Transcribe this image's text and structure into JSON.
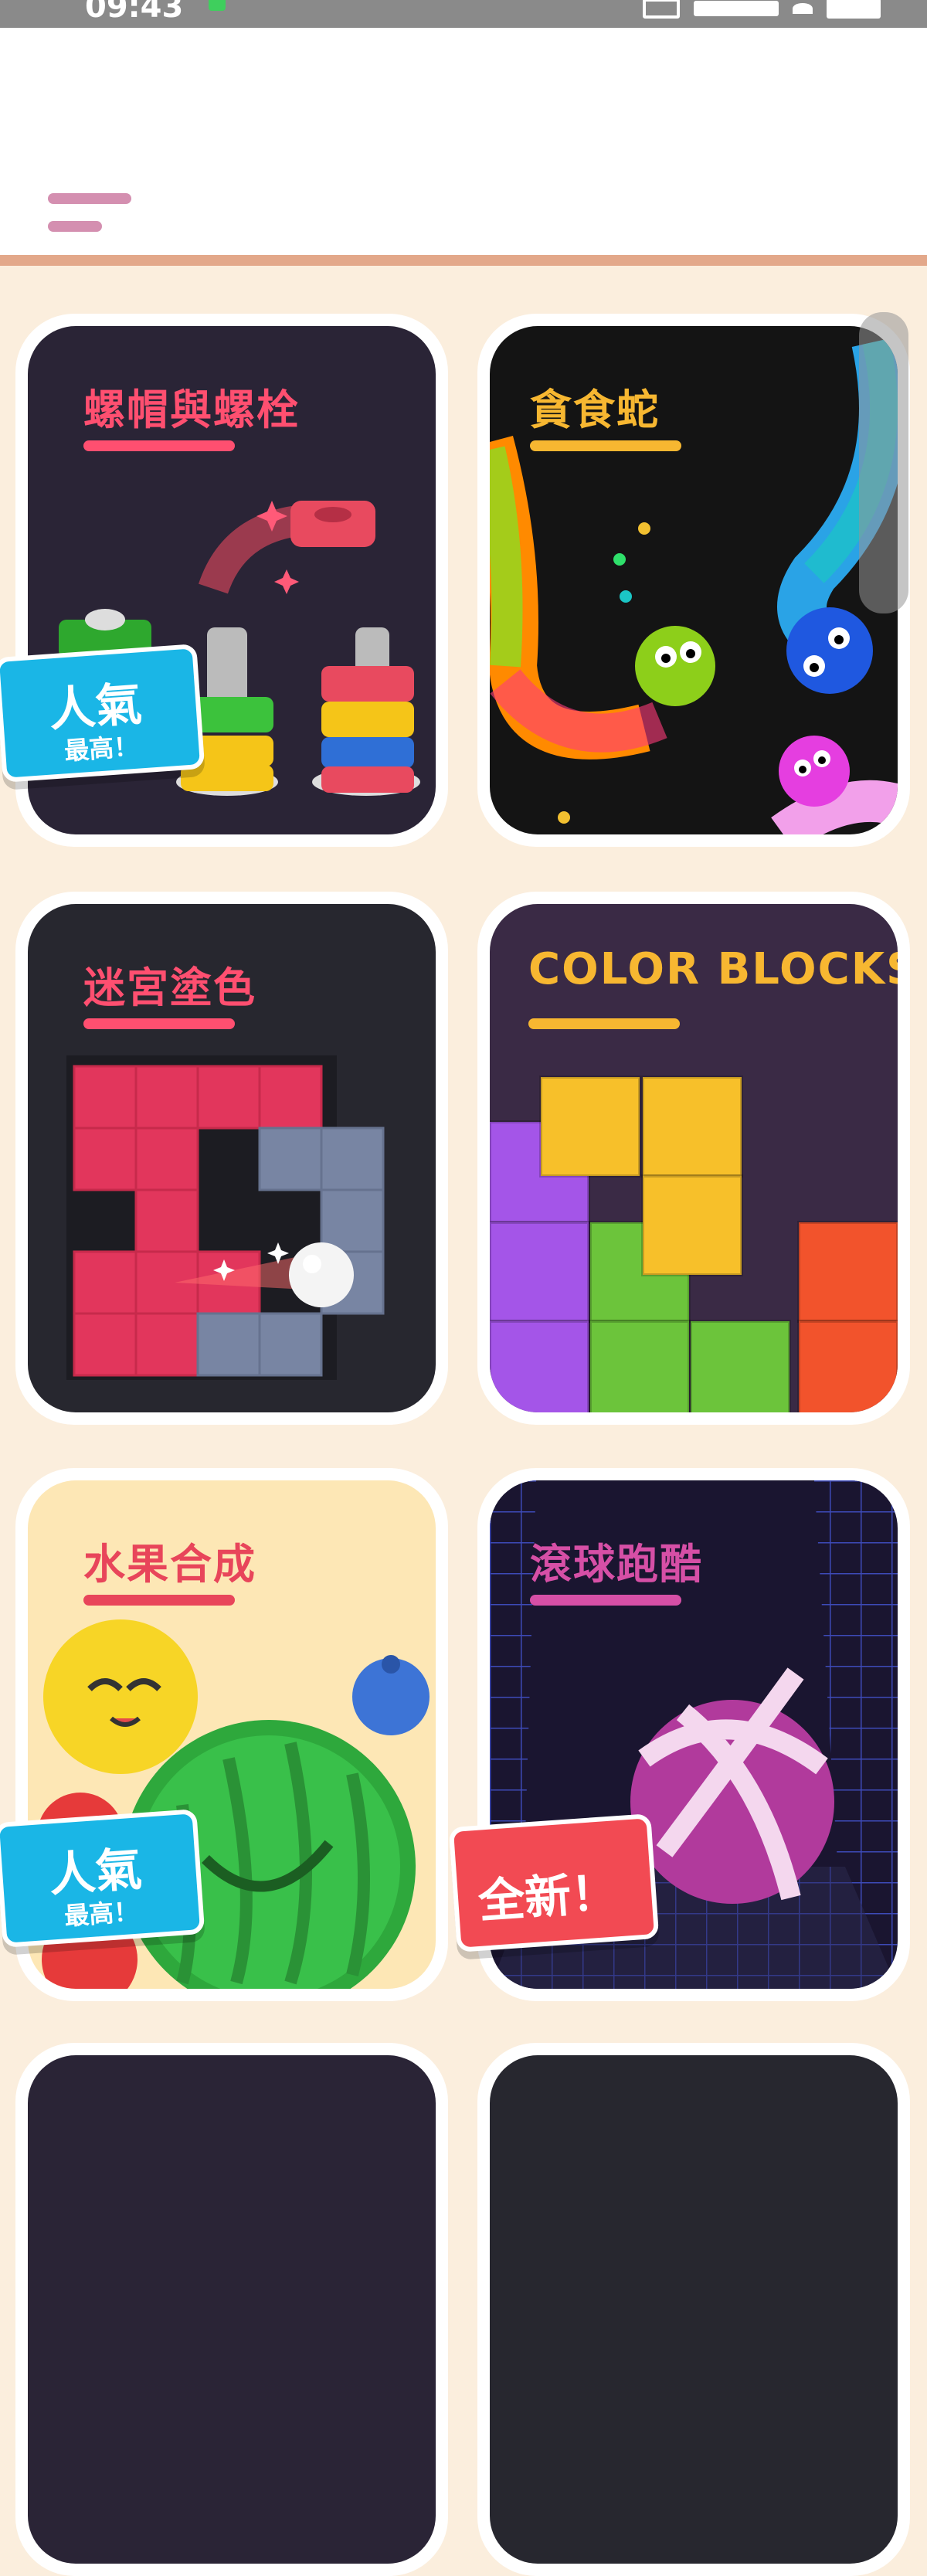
{
  "status_bar": {
    "time": "09:43"
  },
  "header": {
    "menu_label": "menu"
  },
  "cards": [
    {
      "title": "螺帽與螺栓",
      "title_color": "#ff4f70",
      "bg": "#2a2436",
      "badge": {
        "type": "popular",
        "line1": "人氣",
        "line2": "最高！"
      }
    },
    {
      "title": "貪食蛇",
      "title_color": "#f7b731",
      "bg": "#141414"
    },
    {
      "title": "迷宮塗色",
      "title_color": "#ff4f70",
      "bg": "#27272f"
    },
    {
      "title": "COLOR BLOCKS",
      "title_color": "#f7b731",
      "bg": "#3a2a45"
    },
    {
      "title": "水果合成",
      "title_color": "#e8455a",
      "bg": "#fde7b5",
      "badge": {
        "type": "popular",
        "line1": "人氣",
        "line2": "最高！"
      }
    },
    {
      "title": "滾球跑酷",
      "title_color": "#d64fa6",
      "bg": "#1a1530",
      "badge": {
        "type": "new",
        "line1": "全新！"
      }
    }
  ],
  "colors": {
    "accent_pink": "#d48fb0",
    "page_bg": "#fbeedd",
    "rule": "#e3a88a",
    "popular_badge": "#1ab6e6",
    "new_badge": "#f24a53"
  }
}
